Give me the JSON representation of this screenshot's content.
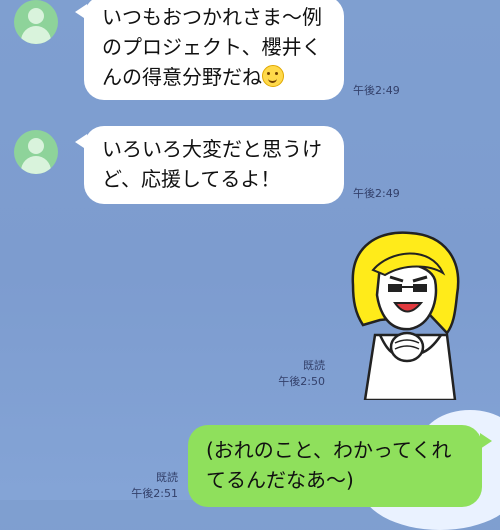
{
  "messages": [
    {
      "sender": "other",
      "lines": [
        "いつもおつかれさま〜例",
        "のプロジェクト、櫻井く",
        "んの得意分野だね"
      ],
      "emoji": "smiling-face-emoji",
      "time": "午後2:49"
    },
    {
      "sender": "other",
      "lines": [
        "いろいろ大変だと思うけ",
        "ど、応援してるよ！"
      ],
      "time": "午後2:49"
    },
    {
      "sender": "me",
      "type": "sticker",
      "sticker": "cheering-blonde-woman-sticker",
      "read": "既読",
      "time": "午後2:50"
    },
    {
      "sender": "me",
      "lines": [
        "(おれのこと、わかってくれ",
        "てるんだなあ〜)"
      ],
      "read": "既読",
      "time": "午後2:51"
    }
  ],
  "colors": {
    "background": "#7f9fd0",
    "other_bubble": "#ffffff",
    "my_bubble": "#8fe05c",
    "avatar": "#8ed39a"
  }
}
